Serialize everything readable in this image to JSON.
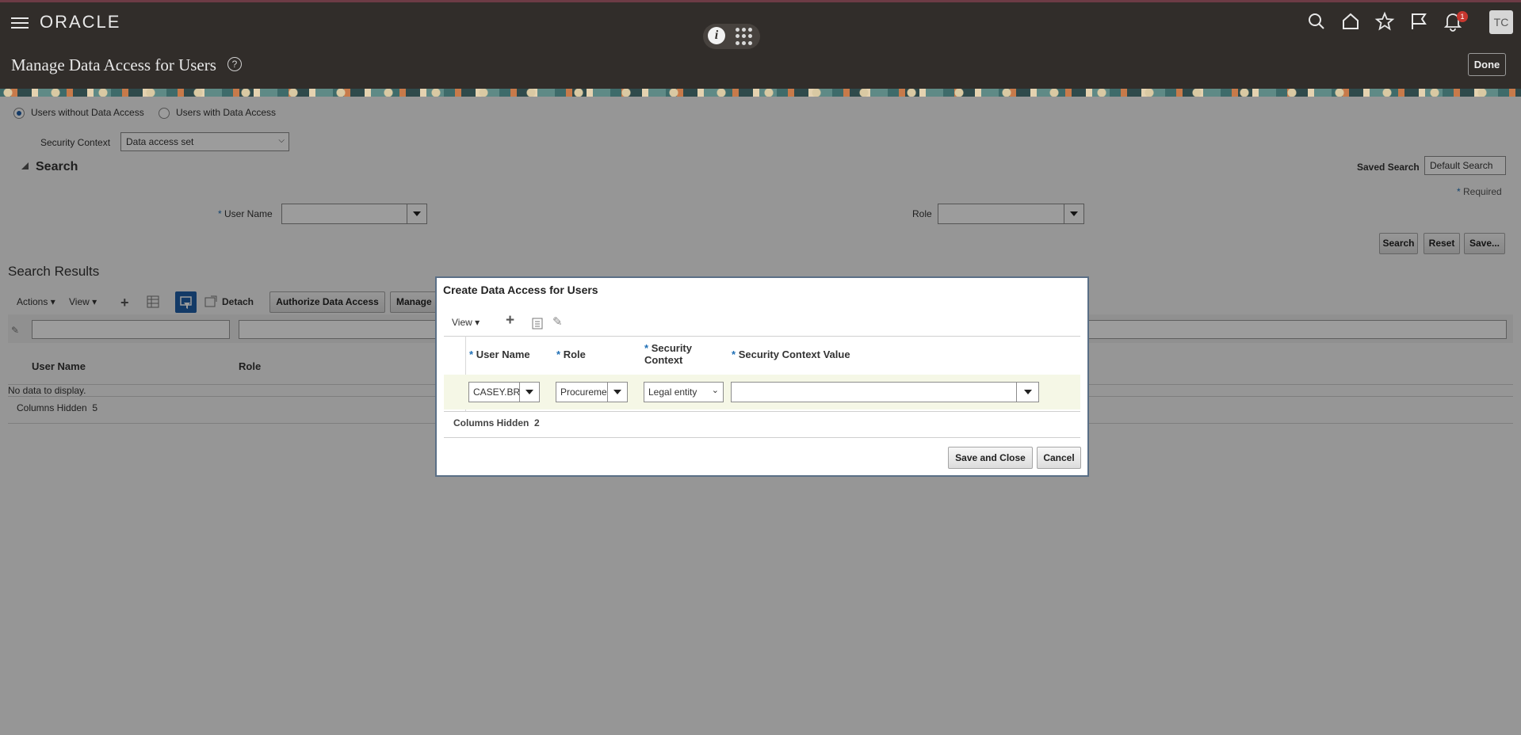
{
  "header": {
    "logo": "ORACLE",
    "page_title": "Manage Data Access for Users",
    "done_label": "Done",
    "avatar_initials": "TC",
    "notification_count": "1"
  },
  "mode": {
    "option_without": "Users without Data Access",
    "option_with": "Users with Data Access",
    "selected": "Users without Data Access"
  },
  "security_context": {
    "label": "Security Context",
    "value": "Data access set"
  },
  "search": {
    "title": "Search",
    "saved_search_label": "Saved Search",
    "saved_search_value": "Default Search",
    "required_label": "Required",
    "user_name_label": "User Name",
    "role_label": "Role",
    "search_button": "Search",
    "reset_button": "Reset",
    "save_button": "Save..."
  },
  "results": {
    "title": "Search Results",
    "actions_menu": "Actions",
    "view_menu": "View",
    "detach_label": "Detach",
    "authorize_button": "Authorize Data Access",
    "manage_button": "Manage",
    "columns": [
      "User Name",
      "Role"
    ],
    "empty_text": "No data to display.",
    "columns_hidden_label": "Columns Hidden",
    "columns_hidden_count": "5"
  },
  "dialog": {
    "title": "Create Data Access for Users",
    "view_menu": "View",
    "columns": {
      "user_name": "User Name",
      "role": "Role",
      "security_context_line1": "Security",
      "security_context_line2": "Context",
      "security_context_value": "Security Context Value"
    },
    "row": {
      "user_name": "CASEY.BR",
      "role": "Procureme",
      "security_context": "Legal entity",
      "security_context_value": ""
    },
    "columns_hidden_label": "Columns Hidden",
    "columns_hidden_count": "2",
    "save_close_button": "Save and Close",
    "cancel_button": "Cancel"
  }
}
